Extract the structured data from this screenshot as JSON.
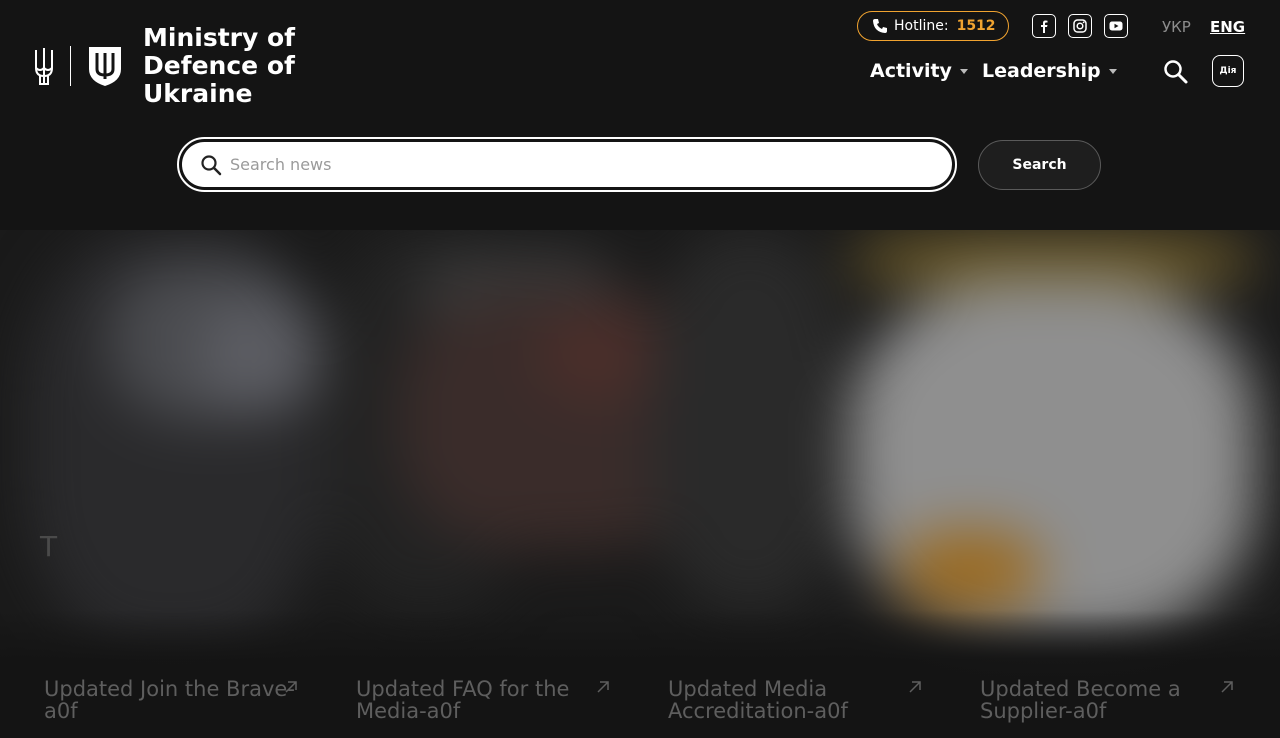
{
  "header": {
    "org_name": "Ministry of Defence of Ukraine",
    "hotline_label": "Hotline:",
    "hotline_number": "1512",
    "social_icons": [
      "facebook-icon",
      "instagram-icon",
      "youtube-icon"
    ],
    "lang_ukr": "УКР",
    "lang_eng": "ENG",
    "active_lang": "ENG",
    "diia_label": "Дія",
    "accent_color": "#f0a330"
  },
  "nav": {
    "items": [
      {
        "label": "Activity"
      },
      {
        "label": "Leadership"
      }
    ]
  },
  "search": {
    "placeholder": "Search news",
    "button_label": "Search"
  },
  "hero": {
    "stray_text": "T"
  },
  "cards": [
    {
      "title": "Updated Join the Brave-a0f"
    },
    {
      "title": "Updated FAQ for the Media-a0f"
    },
    {
      "title": "Updated Media Accreditation-a0f"
    },
    {
      "title": "Updated Become a Supplier-a0f"
    }
  ]
}
